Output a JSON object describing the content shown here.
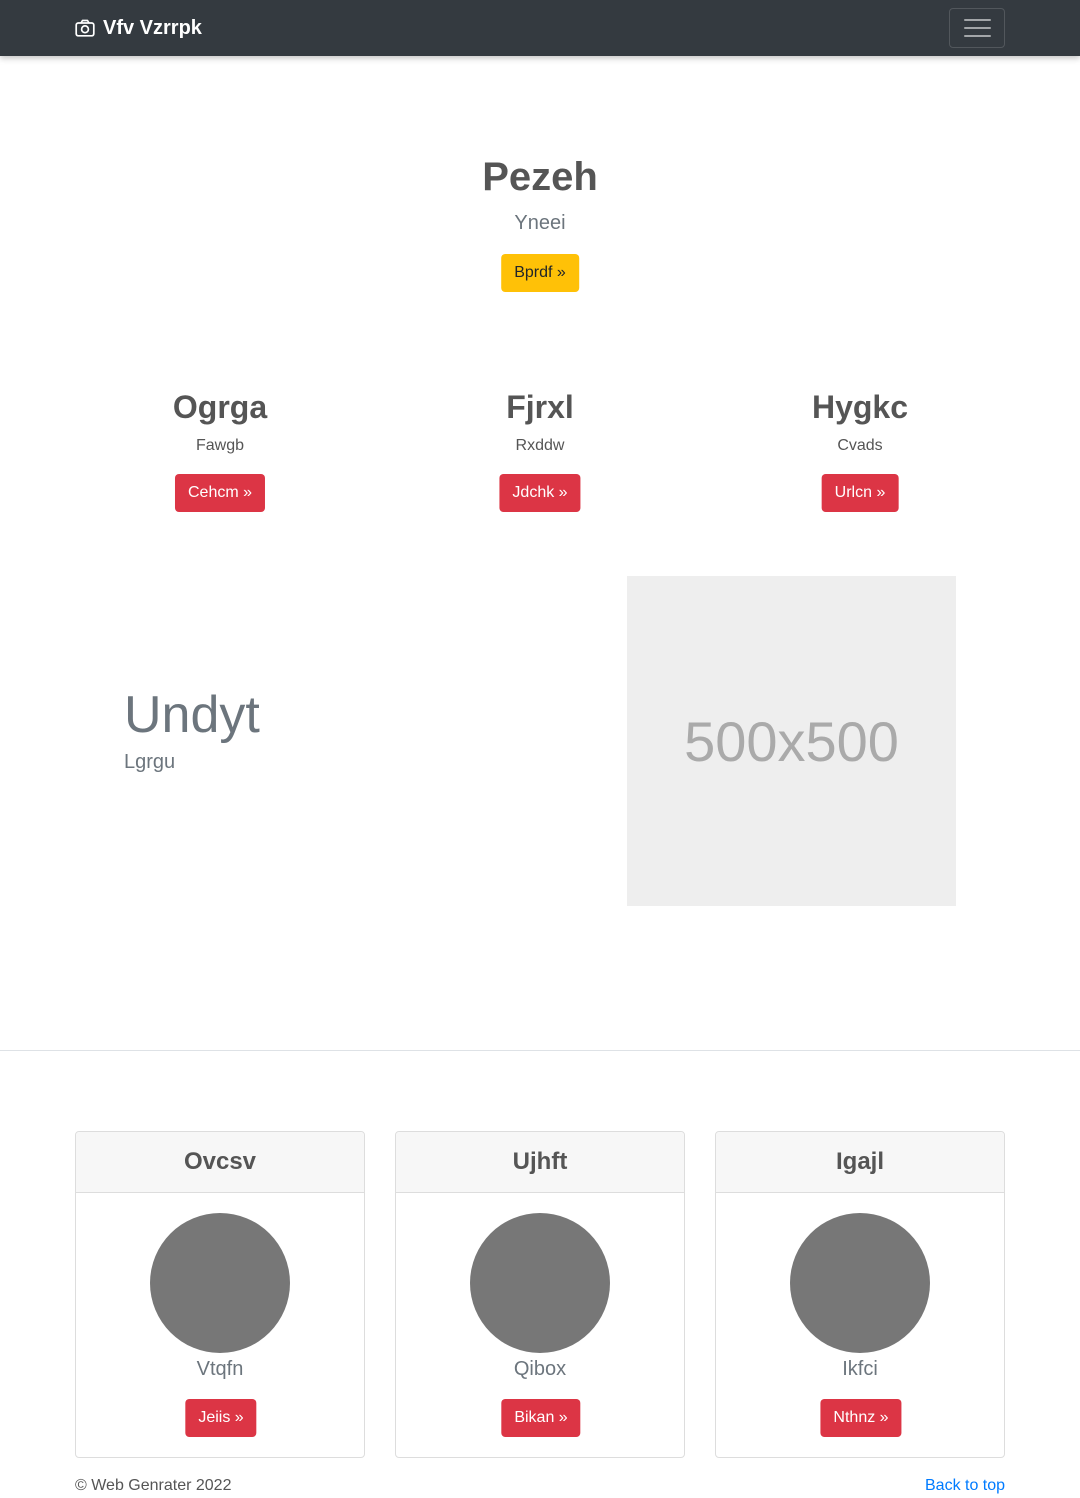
{
  "navbar": {
    "brand": "Vfv Vzrrpk",
    "brand_icon": "camera-icon",
    "toggler_icon": "hamburger-menu-icon"
  },
  "hero": {
    "title": "Pezeh",
    "subtitle": "Yneei",
    "button": "Bprdf »"
  },
  "columns": [
    {
      "title": "Ogrga",
      "subtitle": "Fawgb",
      "button": "Cehcm »"
    },
    {
      "title": "Fjrxl",
      "subtitle": "Rxddw",
      "button": "Jdchk »"
    },
    {
      "title": "Hygkc",
      "subtitle": "Cvads",
      "button": "Urlcn »"
    }
  ],
  "feature": {
    "title": "Undyt",
    "subtitle": "Lgrgu",
    "image_label": "500x500"
  },
  "cards": [
    {
      "header": "Ovcsv",
      "text": "Vtqfn",
      "button": "Jeiis »"
    },
    {
      "header": "Ujhft",
      "text": "Qibox",
      "button": "Bikan »"
    },
    {
      "header": "Igajl",
      "text": "Ikfci",
      "button": "Nthnz »"
    }
  ],
  "footer": {
    "copyright": "© Web Genrater 2022",
    "back_to_top": "Back to top"
  },
  "colors": {
    "navbar_bg": "#343a40",
    "warning": "#ffc107",
    "danger": "#dc3545",
    "link": "#007bff",
    "avatar": "#777777",
    "placeholder_bg": "#eeeeee"
  }
}
